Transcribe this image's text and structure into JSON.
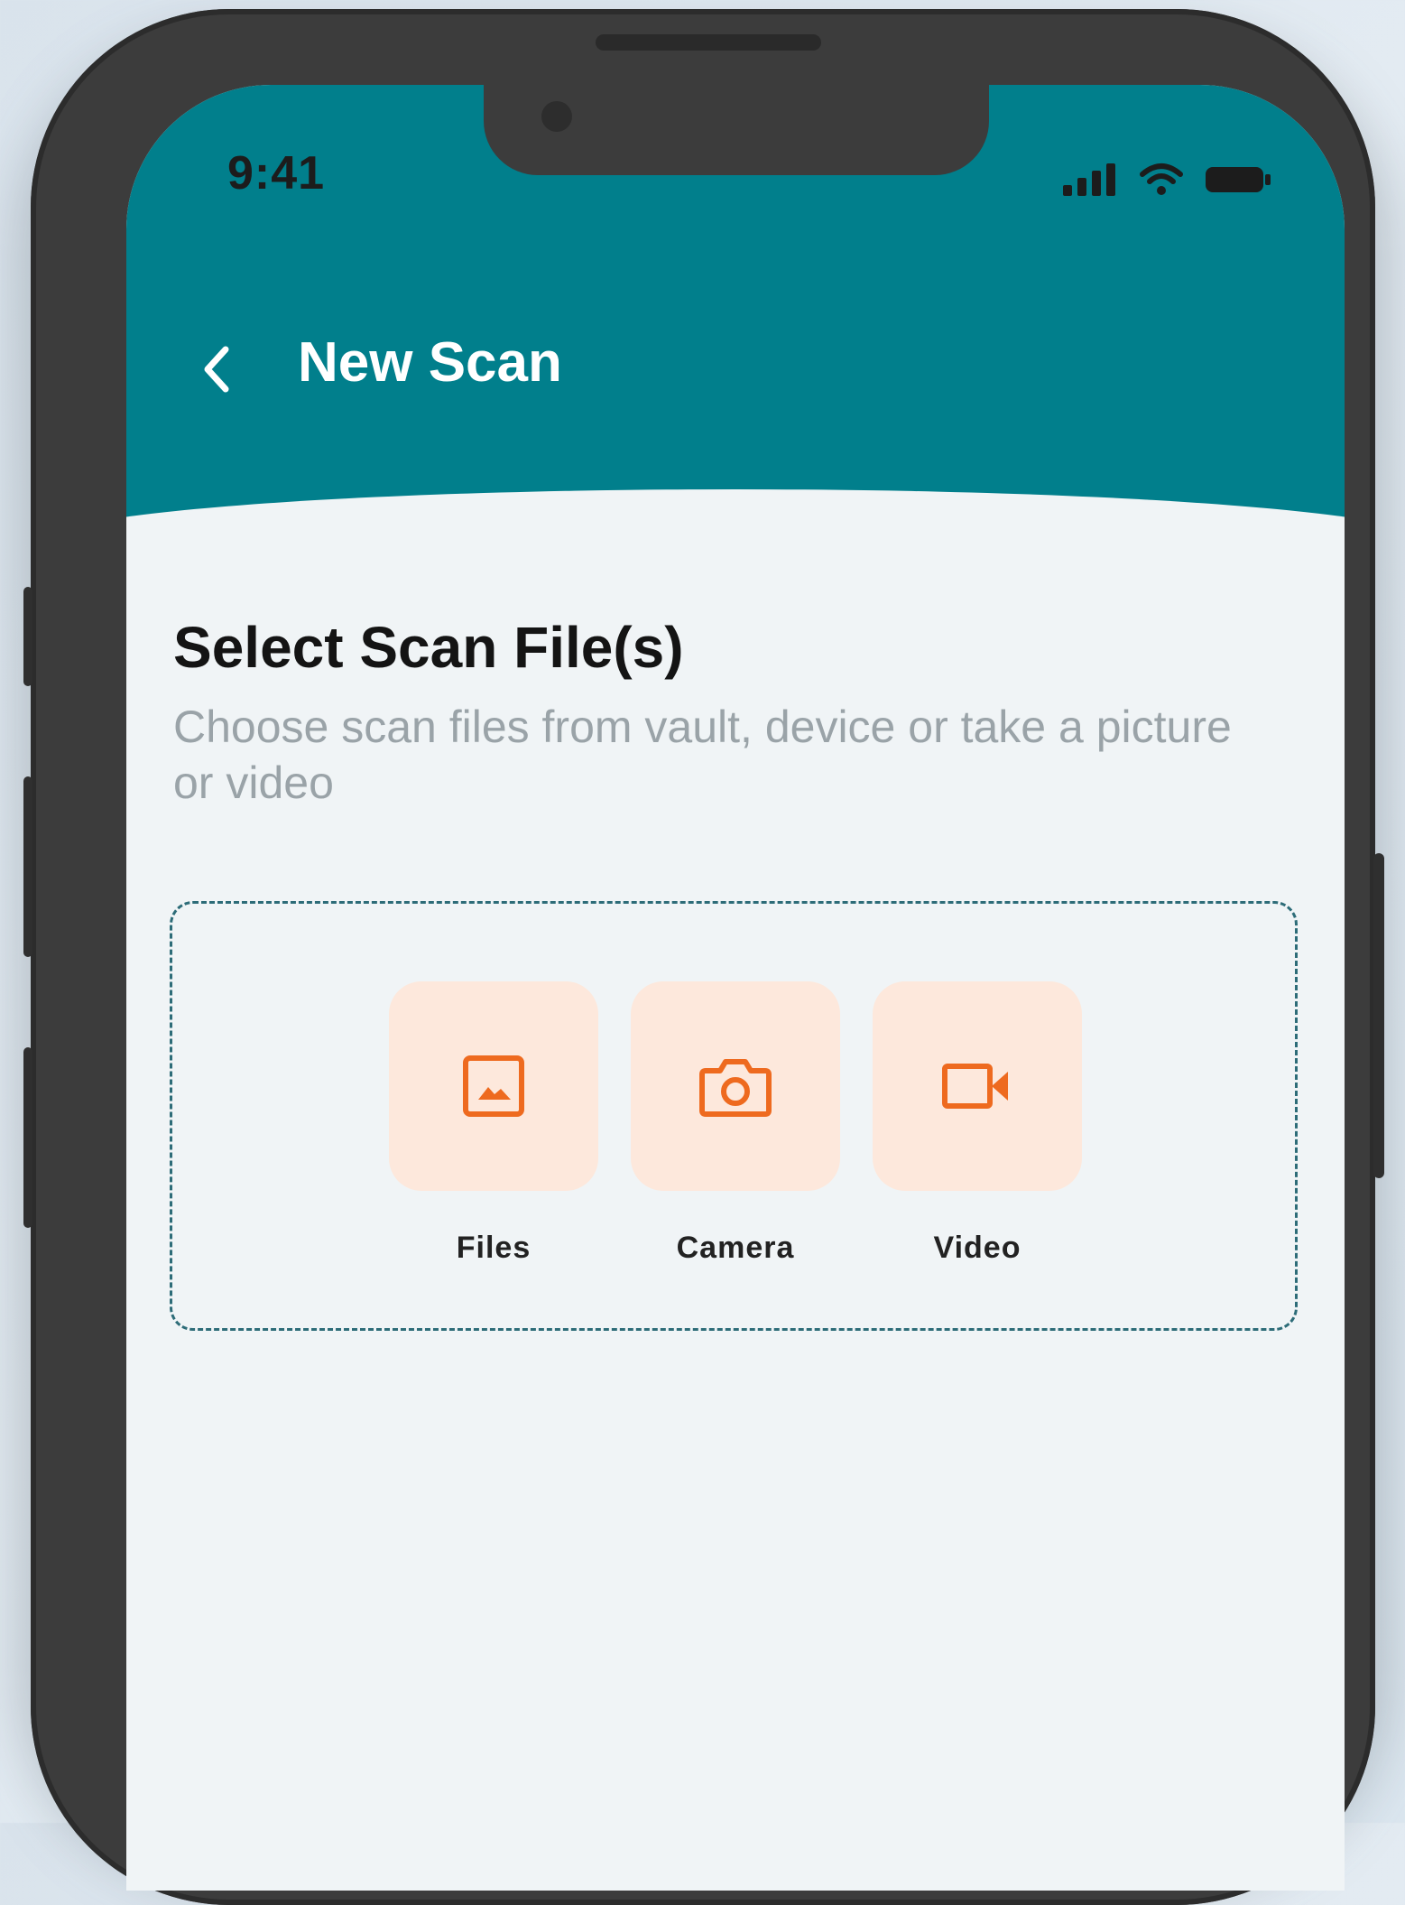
{
  "status_bar": {
    "time": "9:41"
  },
  "header": {
    "title": "New Scan"
  },
  "main": {
    "heading": "Select Scan File(s)",
    "subheading": "Choose scan files from vault, device or take a picture or video"
  },
  "options": [
    {
      "label": "Files",
      "icon": "image-icon"
    },
    {
      "label": "Camera",
      "icon": "camera-icon"
    },
    {
      "label": "Video",
      "icon": "video-icon"
    }
  ],
  "colors": {
    "header": "#017f8c",
    "accent": "#ee6a1f",
    "tile": "#fde8dc",
    "background": "#f0f4f6"
  }
}
